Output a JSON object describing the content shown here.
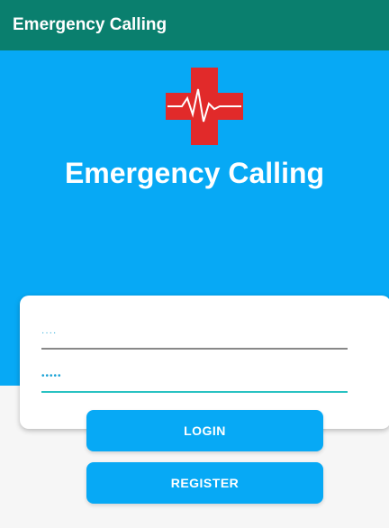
{
  "app_bar": {
    "title": "Emergency Calling"
  },
  "hero": {
    "title": "Emergency Calling",
    "logo_icon": "medical-cross-heartbeat-icon"
  },
  "form": {
    "username": {
      "placeholder_text": "····"
    },
    "password": {
      "placeholder_text": "•••••"
    }
  },
  "buttons": {
    "login_label": "LOGIN",
    "register_label": "REGISTER"
  },
  "colors": {
    "app_bar": "#0a7f6e",
    "hero_background": "#07a9f5",
    "button": "#07a9f5",
    "cross": "#e12a2a",
    "password_underline": "#29c2c2"
  }
}
